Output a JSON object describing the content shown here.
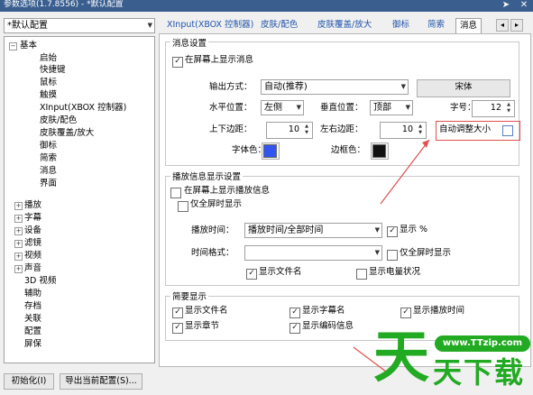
{
  "window": {
    "title": "参数选项(1.7.8556) - *默认配置",
    "pin_icon": "pin-icon",
    "close_icon": "close-icon"
  },
  "profile": {
    "selected": "*默认配置"
  },
  "tree": {
    "basic": {
      "label": "基本",
      "expander": "−",
      "children": [
        "启始",
        "快捷键",
        "鼠标",
        "触摸",
        "XInput(XBOX 控制器)",
        "皮肤/配色",
        "皮肤覆盖/放大",
        "御标",
        "简索",
        "消息",
        "界面"
      ]
    },
    "collapsed": [
      "播放",
      "字幕",
      "设备",
      "滤镜",
      "视频",
      "声音"
    ],
    "leaves": [
      "3D 视频",
      "辅助",
      "存档",
      "关联",
      "配置",
      "屏保"
    ],
    "expander_plus": "+"
  },
  "tabs": {
    "items": [
      "XInput(XBOX 控制器)",
      "皮肤/配色",
      "皮肤覆盖/放大",
      "御标",
      "简索",
      "消息"
    ],
    "selected_index": 5,
    "prev": "◂",
    "next": "▸"
  },
  "msg_settings": {
    "title": "消息设置",
    "show_on_screen": {
      "label": "在屏幕上显示消息",
      "checked": true
    },
    "output_mode": {
      "label": "输出方式：",
      "value": "自动(推荐)"
    },
    "font_button": "宋体",
    "h_pos": {
      "label": "水平位置：",
      "value": "左侧"
    },
    "v_pos": {
      "label": "垂直位置：",
      "value": "顶部"
    },
    "font_size": {
      "label": "字号：",
      "value": "12"
    },
    "tb_margin": {
      "label": "上下边距：",
      "value": "10"
    },
    "lr_margin": {
      "label": "左右边距：",
      "value": "10"
    },
    "auto_size": {
      "label": "自动调整大小",
      "checked": false
    },
    "font_color": {
      "label": "字体色：",
      "color": "#3355ee"
    },
    "border_color": {
      "label": "边框色：",
      "color": "#111111"
    }
  },
  "play_info": {
    "title": "播放信息显示设置",
    "show_on_screen": {
      "label": "在屏幕上显示播放信息",
      "checked": false
    },
    "fullscreen_only": {
      "label": "仅全屏时显示",
      "checked": false
    },
    "play_time": {
      "label": "播放时间：",
      "value": "播放时间/全部时间"
    },
    "show_percent": {
      "label": "显示 %",
      "checked": true
    },
    "time_format": {
      "label": "时间格式：",
      "value": ""
    },
    "fs_time_only": {
      "label": "仅全屏时显示",
      "checked": false
    },
    "show_filename": {
      "label": "显示文件名",
      "checked": true
    },
    "show_battery": {
      "label": "显示电量状况",
      "checked": false
    }
  },
  "brief": {
    "title": "简要显示",
    "items": [
      {
        "label": "显示文件名",
        "checked": true
      },
      {
        "label": "显示字幕名",
        "checked": true
      },
      {
        "label": "显示播放时间",
        "checked": true
      },
      {
        "label": "显示章节",
        "checked": true
      },
      {
        "label": "显示编码信息",
        "checked": true
      }
    ]
  },
  "footer": {
    "init_button": "初始化(I)",
    "export_button": "导出当前配置(S)..."
  },
  "watermark": {
    "url": "www.TTzip.com",
    "text": "天下载",
    "logo_char": "天",
    "green": "#22aa22"
  },
  "colors": {
    "annotation": "#e05050",
    "link": "#2255aa"
  }
}
